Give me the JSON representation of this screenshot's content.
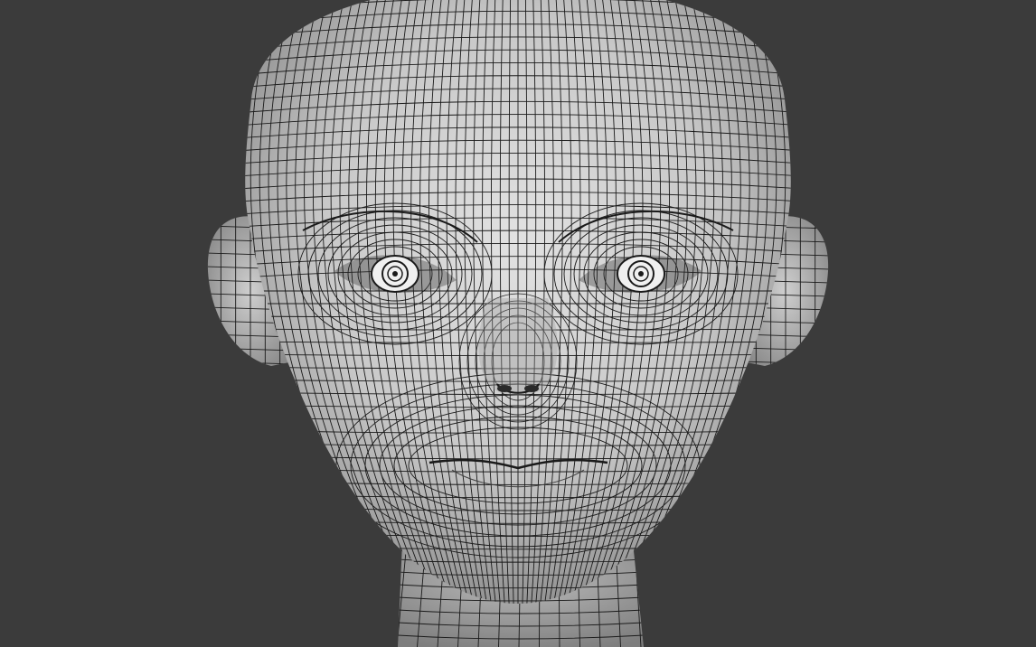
{
  "viewport": {
    "background_color": "#3b3b3b",
    "mesh_fill_light": "#d9d9d9",
    "mesh_fill_dark": "#9a9a9a",
    "wire_color": "#1a1a1a",
    "subject": "wireframe-head-mesh"
  }
}
